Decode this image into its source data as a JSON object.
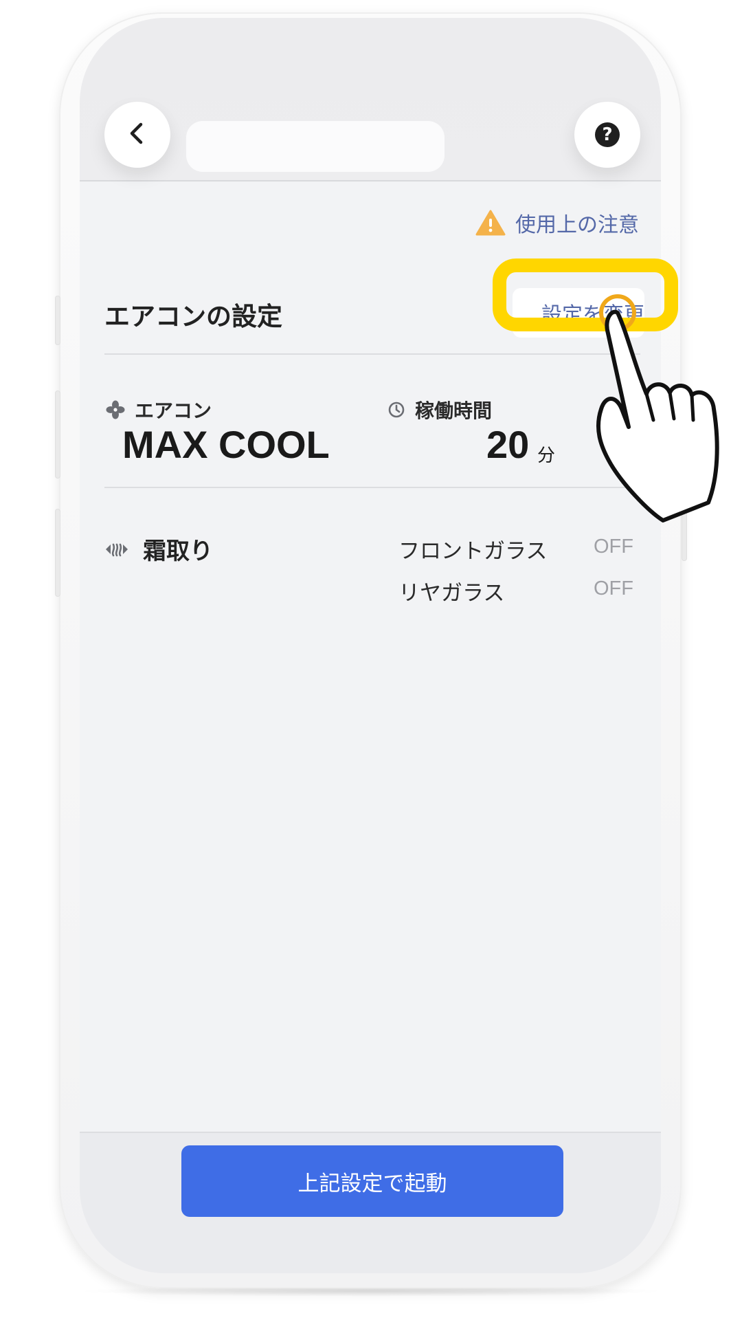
{
  "header": {
    "back_icon": "chevron-left-icon",
    "help_icon": "question-circle-icon"
  },
  "caution": {
    "icon": "warning-triangle-icon",
    "label": "使用上の注意",
    "icon_color": "#f4b24a"
  },
  "settings": {
    "title": "エアコンの設定",
    "change_label": "設定を変更"
  },
  "aircon": {
    "icon": "fan-icon",
    "label": "エアコン",
    "value": "MAX COOL"
  },
  "runtime": {
    "icon": "clock-icon",
    "label": "稼働時間",
    "value": "20",
    "unit": "分"
  },
  "defrost": {
    "icon": "defrost-icon",
    "label": "霜取り",
    "items": [
      {
        "label": "フロントガラス",
        "value": "OFF"
      },
      {
        "label": "リヤガラス",
        "value": "OFF"
      }
    ]
  },
  "footer": {
    "start_label": "上記設定で起動"
  },
  "tutorial": {
    "highlight_color": "#ffd600",
    "pointer_icon": "tap-hand-icon"
  },
  "colors": {
    "accent_blue": "#3f6de6",
    "link_blue": "#5468a8",
    "background": "#f2f3f5"
  }
}
